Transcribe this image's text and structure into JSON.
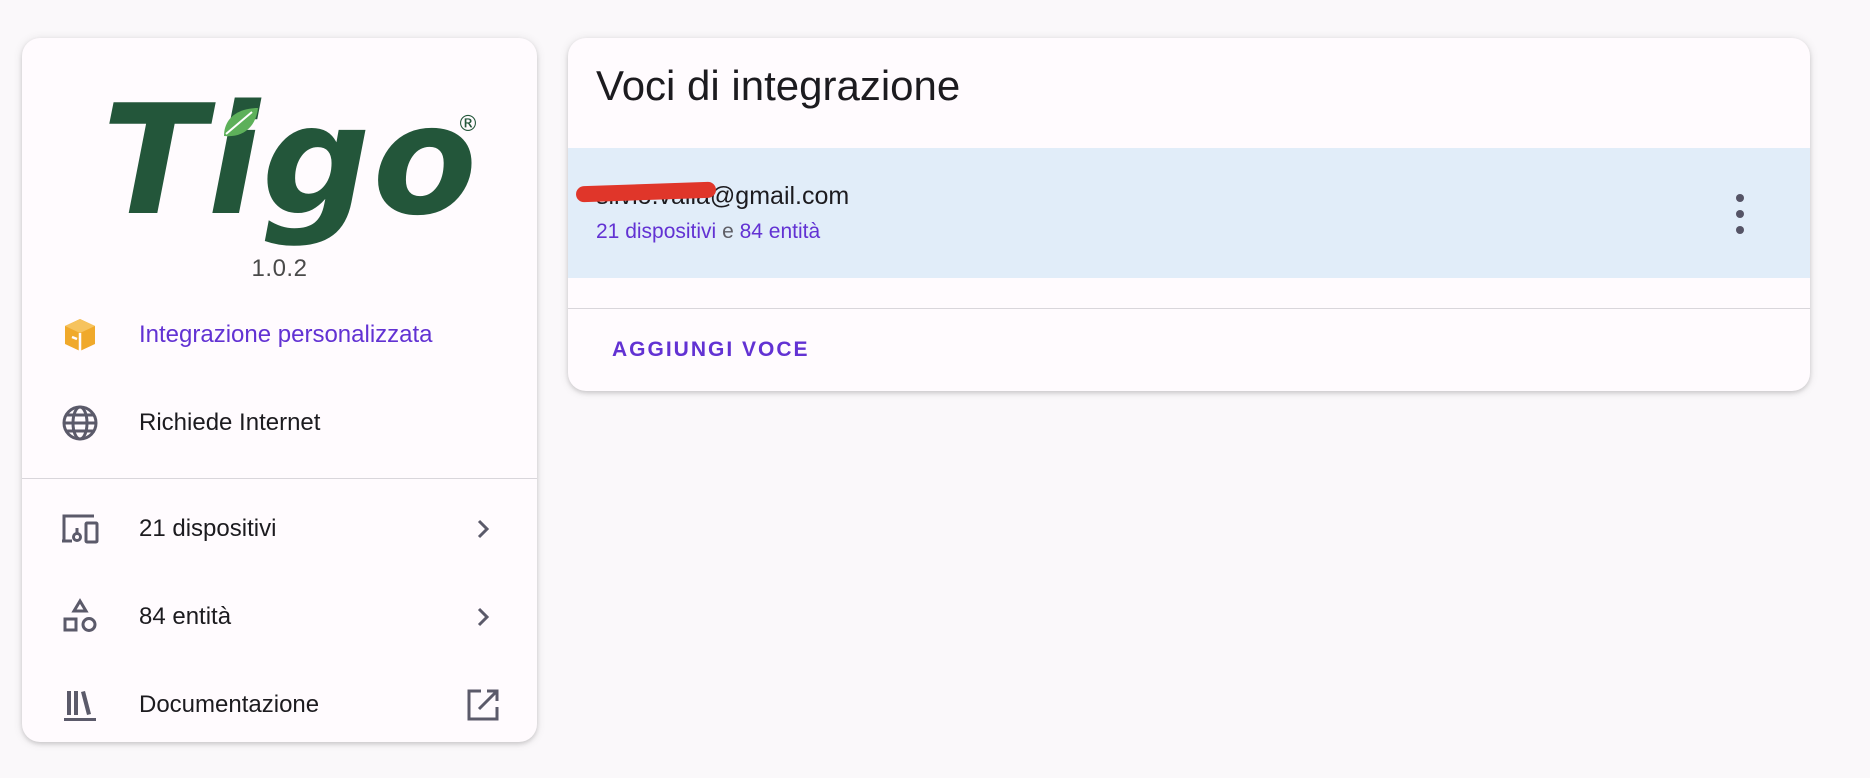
{
  "integration": {
    "logo_text": "Tigo",
    "logo_registered": "®",
    "version": "1.0.2"
  },
  "info": {
    "custom_label": "Integrazione personalizzata",
    "internet_label": "Richiede Internet"
  },
  "links": {
    "devices_label": "21 dispositivi",
    "entities_label": "84 entità",
    "docs_label": "Documentazione"
  },
  "entries": {
    "title": "Voci di integrazione",
    "items": [
      {
        "email": "silvio.valla@gmail.com",
        "devices": "21 dispositivi",
        "conjunction": "e",
        "entities": "84 entità"
      }
    ],
    "add_label": "AGGIUNGI VOCE"
  },
  "colors": {
    "accent": "#6232d3",
    "brand_green": "#23563a",
    "custom_icon": "#f0a92b",
    "entry_bg": "#e1edf9"
  },
  "icons": {
    "custom": "package-icon",
    "internet": "globe-icon",
    "devices": "devices-icon",
    "entities": "shapes-icon",
    "docs": "bookshelf-icon",
    "chevron": "chevron-right-icon",
    "external": "open-in-new-icon",
    "menu": "dots-vertical-icon"
  }
}
